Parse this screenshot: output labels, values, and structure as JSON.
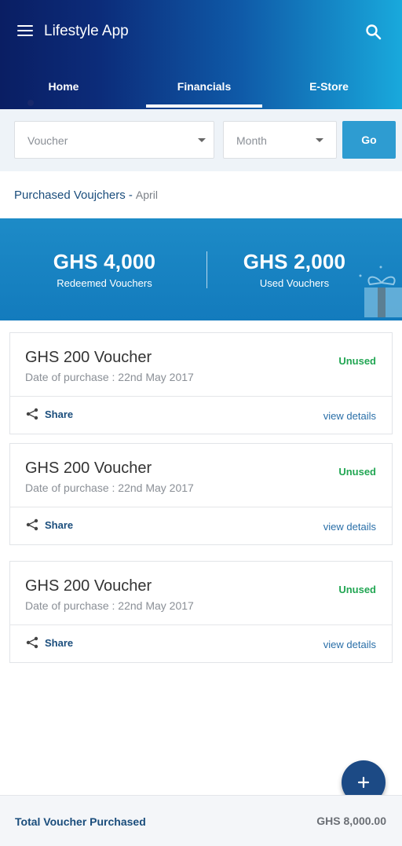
{
  "app": {
    "title": "Lifestyle App",
    "tabs": [
      {
        "label": "Home",
        "active": false
      },
      {
        "label": "Financials",
        "active": true
      },
      {
        "label": "E-Store",
        "active": false
      }
    ]
  },
  "filters": {
    "voucher_placeholder": "Voucher",
    "month_placeholder": "Month",
    "go_label": "Go"
  },
  "section": {
    "title": "Purchased Voujchers -",
    "month": "April"
  },
  "summary": {
    "redeemed_amount": "GHS 4,000",
    "redeemed_label": "Redeemed Vouchers",
    "used_amount": "GHS 2,000",
    "used_label": "Used Vouchers"
  },
  "vouchers": [
    {
      "title": "GHS 200 Voucher",
      "date": "Date of purchase : 22nd May 2017",
      "status": "Unused",
      "share": "Share",
      "details": "view details"
    },
    {
      "title": "GHS 200 Voucher",
      "date": "Date of purchase : 22nd May 2017",
      "status": "Unused",
      "share": "Share",
      "details": "view details"
    },
    {
      "title": "GHS 200 Voucher",
      "date": "Date of purchase : 22nd May 2017",
      "status": "Unused",
      "share": "Share",
      "details": "view details"
    }
  ],
  "footer": {
    "label": "Total Voucher Purchased",
    "value": "GHS 8,000.00"
  },
  "icons": {
    "menu": "menu-icon",
    "search": "search-icon",
    "share": "share-icon",
    "add": "plus-icon",
    "gift": "gift-icon"
  },
  "colors": {
    "brand_dark": "#0a1e63",
    "brand_light": "#19a9dc",
    "banner": "#1d8bc7",
    "go_button": "#2e9cd1",
    "status_green": "#22a653",
    "fab": "#1c4a85"
  }
}
